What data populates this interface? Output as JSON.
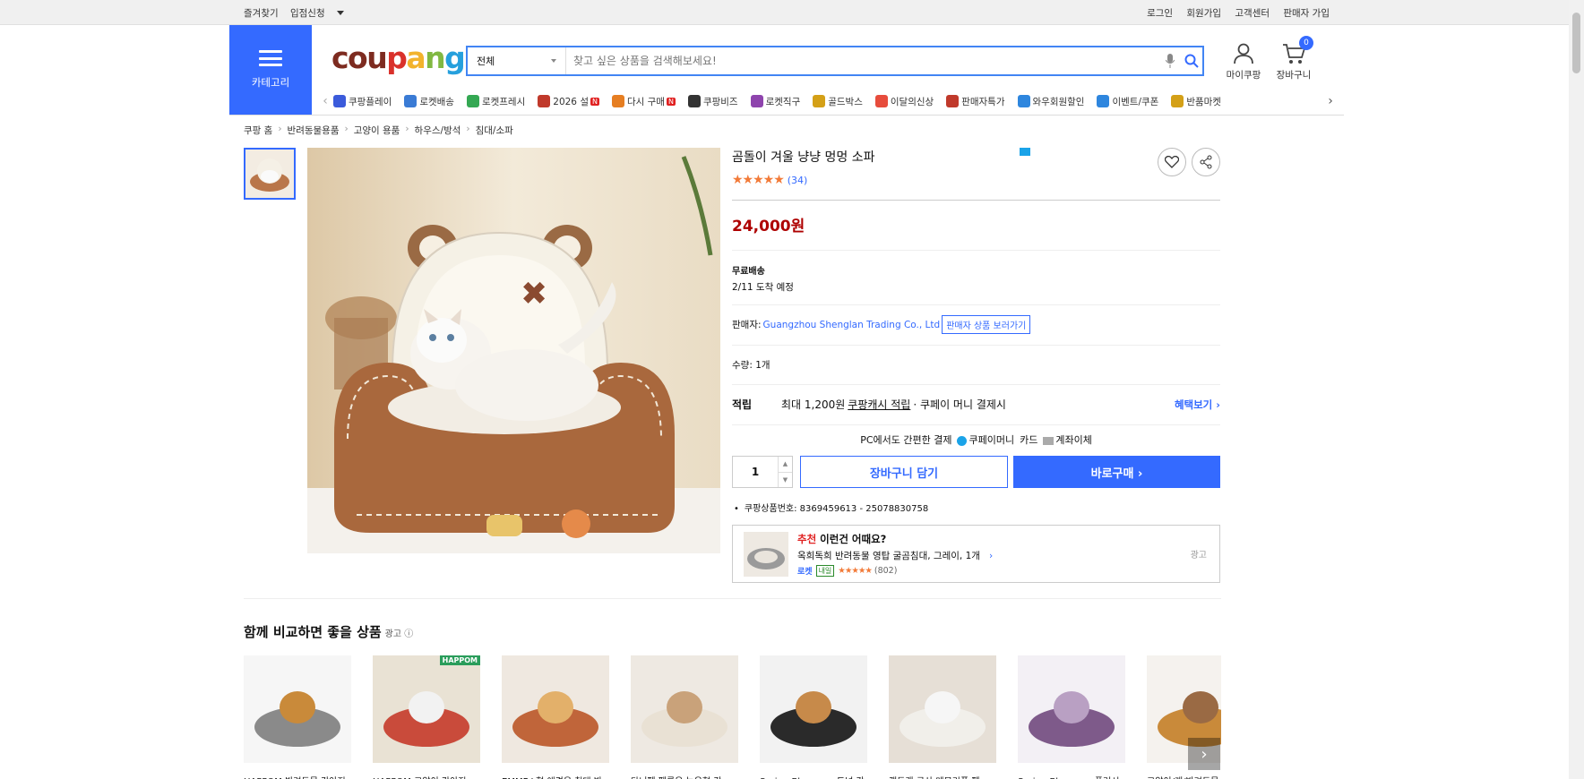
{
  "util": {
    "left": [
      "즐겨찾기",
      "입점신청"
    ],
    "right": [
      "로그인",
      "회원가입",
      "고객센터",
      "판매자 가입"
    ]
  },
  "header": {
    "category_label": "카테고리",
    "logo": {
      "c1": "cou",
      "c2": "p",
      "c3": "a",
      "c4": "n",
      "c5": "g"
    },
    "search_scope": "전체",
    "search_placeholder": "찾고 싶은 상품을 검색해보세요!",
    "mycoupang": "마이쿠팡",
    "cart": "장바구니",
    "cart_count": "0"
  },
  "quick_links": [
    {
      "label": "쿠팡플레이",
      "color": "#3b5bdb",
      "badge": ""
    },
    {
      "label": "로켓배송",
      "color": "#3a7bd5",
      "badge": ""
    },
    {
      "label": "로켓프레시",
      "color": "#34a853",
      "badge": ""
    },
    {
      "label": "2026 설",
      "color": "#c0392b",
      "badge": "N"
    },
    {
      "label": "다시 구매",
      "color": "#e67e22",
      "badge": "N"
    },
    {
      "label": "쿠팡비즈",
      "color": "#333333",
      "badge": ""
    },
    {
      "label": "로켓직구",
      "color": "#8e44ad",
      "badge": ""
    },
    {
      "label": "골드박스",
      "color": "#d4a017",
      "badge": ""
    },
    {
      "label": "이달의신상",
      "color": "#e74c3c",
      "badge": ""
    },
    {
      "label": "판매자특가",
      "color": "#c0392b",
      "badge": ""
    },
    {
      "label": "와우회원할인",
      "color": "#2e86de",
      "badge": ""
    },
    {
      "label": "이벤트/쿠폰",
      "color": "#2e86de",
      "badge": ""
    },
    {
      "label": "반품마켓",
      "color": "#d4a017",
      "badge": ""
    }
  ],
  "breadcrumb": [
    "쿠팡 홈",
    "반려동물용품",
    "고양이 용품",
    "하우스/방석",
    "침대/소파"
  ],
  "product": {
    "title": "곰돌이 겨울 냥냥 멍멍 소파",
    "stars": "★★★★★",
    "review_count": "(34)",
    "price": "24,000원",
    "shipping_label": "무료배송",
    "arrival": "2/11 도착 예정",
    "seller_prefix": "판매자:",
    "seller_name": "Guangzhou Shenglan Trading Co., Ltd",
    "seller_button": "판매자 상품 보러가기",
    "quantity_text": "수량: 1개",
    "reward_label": "적립",
    "reward_text1": "최대 1,200원",
    "reward_text2": "쿠팡캐시 적립",
    "reward_text3": "· 쿠페이 머니 결제시",
    "reward_more": "혜택보기 ›",
    "pay_title": "PC에서도 간편한 결제",
    "pay_methods": [
      "쿠페이머니",
      "카드",
      "계좌이체"
    ],
    "qty_value": "1",
    "add_cart": "장바구니 담기",
    "buy_now": "바로구매 ›",
    "product_id": "쿠팡상품번호: 8369459613 - 25078830758"
  },
  "recommend": {
    "prefix": "추천",
    "title": " 이런건 어때요?",
    "name": "옥희독희 반려동물 영탑 굴곰침대, 그레이, 1개",
    "rocket": "로켓",
    "tomorrow": "내일",
    "stars": "★★★★★",
    "count": "(802)",
    "ad": "광고"
  },
  "compare": {
    "title": "함께 비교하면 좋을 상품",
    "ad": "광고 ⓘ",
    "items": [
      {
        "name": "HAPPOM 반려동물 강아지 ..."
      },
      {
        "name": "HAPPOM 고양이 강아지 ..."
      },
      {
        "name": "EMMF L형 애견용 침대 반..."
      },
      {
        "name": "다니펫 펫룸은 높은형 강..."
      },
      {
        "name": "Spring Blossoms 도넛 강..."
      },
      {
        "name": "캣독랜 국산 메모리폼 펫..."
      },
      {
        "name": "Spring Blossoms 플러시..."
      },
      {
        "name": "고양이/개/반려동물..."
      }
    ],
    "hap_badge": "HAPPOM"
  }
}
